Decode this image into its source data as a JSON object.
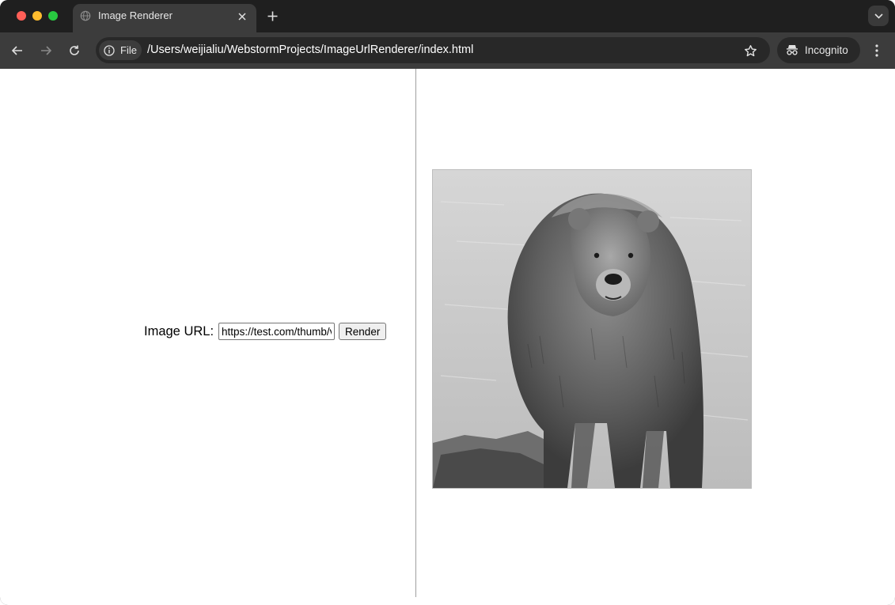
{
  "tab": {
    "title": "Image Renderer",
    "favicon": "globe-icon",
    "close_icon": "close-icon"
  },
  "toolbar": {
    "back_icon": "arrow-left-icon",
    "forward_icon": "arrow-right-icon",
    "reload_icon": "reload-icon",
    "site_chip_label": "File",
    "site_chip_icon": "info-icon",
    "url": "/Users/weijialiu/WebstormProjects/ImageUrlRenderer/index.html",
    "bookmark_icon": "star-icon",
    "profile_label": "Incognito",
    "profile_icon": "incognito-icon",
    "menu_icon": "kebab-menu-icon"
  },
  "colors": {
    "frame": "#1f1f1f",
    "toolbar": "#3c3c3c",
    "omnibox": "#282828",
    "close": "#ff5f57",
    "minimize": "#febc2e",
    "maximize": "#28c840"
  },
  "page": {
    "url_label": "Image URL:",
    "url_input_value": "https://test.com/thumb/v",
    "render_button_label": "Render",
    "image_subject": "grayscale photo of a brown bear standing on rocks by water"
  }
}
